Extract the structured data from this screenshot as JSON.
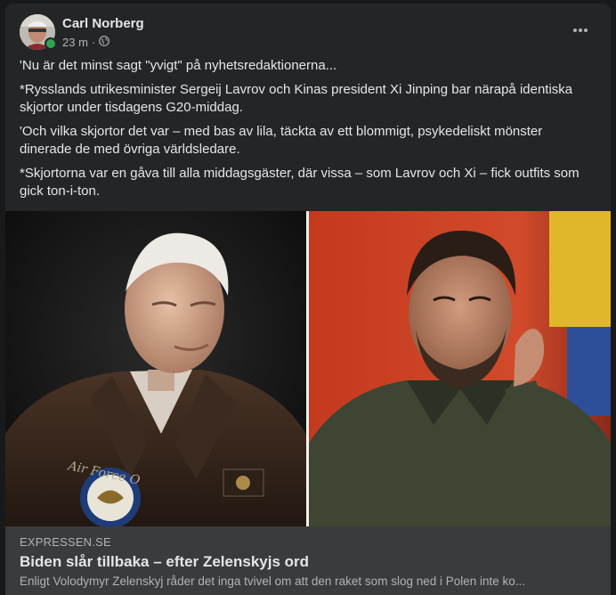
{
  "post": {
    "author": "Carl Norberg",
    "time": "23 m",
    "privacy_icon": "globe-icon",
    "more_icon": "more-options-icon",
    "online": true,
    "paragraphs": [
      "'Nu är det minst sagt \"yvigt\" på nyhetsredaktionerna...",
      "*Rysslands utrikesminister Sergeij Lavrov och Kinas president Xi Jinping bar närapå identiska skjortor under tisdagens G20-middag.",
      "'Och vilka skjortor det var – med bas av lila, täckta av ett blommigt, psykedeliskt mönster dinerade de med övriga världsledare.",
      "*Skjortorna var en gåva till alla middagsgäster, där vissa – som Lavrov och Xi – fick outfits som gick ton-i-ton."
    ]
  },
  "link": {
    "domain": "EXPRESSEN.SE",
    "title": "Biden slår tillbaka – efter Zelenskyjs ord",
    "description": "Enligt Volodymyr Zelenskyj råder det inga tvivel om att den raket som slog ned i Polen inte ko..."
  },
  "colors": {
    "background": "#18191a",
    "card": "#242526",
    "link_preview": "#3a3b3c",
    "online": "#31a24c"
  }
}
